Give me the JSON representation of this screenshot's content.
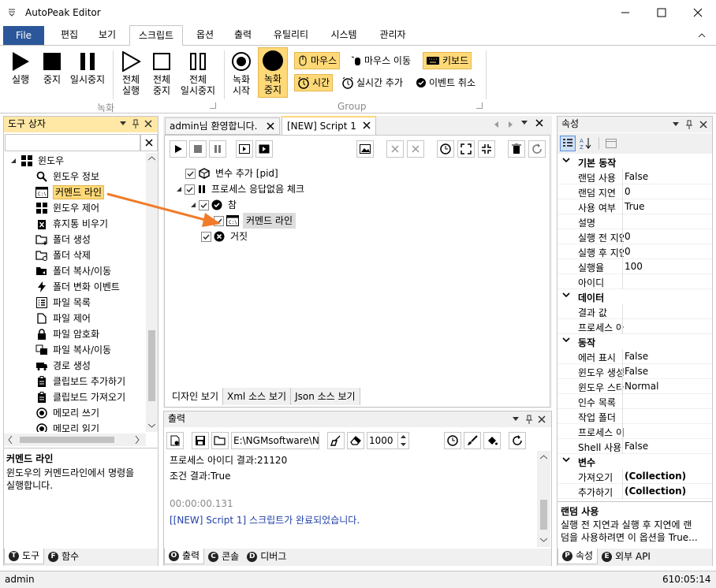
{
  "window": {
    "title": "AutoPeak Editor"
  },
  "menu": {
    "tabs": [
      "File",
      "편집",
      "보기",
      "스크립트",
      "옵션",
      "출력",
      "유틸리티",
      "시스템",
      "관리자"
    ],
    "active": "스크립트"
  },
  "ribbon": {
    "rec_buttons": [
      {
        "line1": "실행",
        "line2": ""
      },
      {
        "line1": "중지",
        "line2": ""
      },
      {
        "line1": "일시중지",
        "line2": ""
      },
      {
        "line1": "전체",
        "line2": "실행"
      },
      {
        "line1": "전체",
        "line2": "중지"
      },
      {
        "line1": "전체",
        "line2": "일시중지"
      }
    ],
    "rec_group_label": "녹화",
    "record_start": {
      "line1": "녹화",
      "line2": "시작"
    },
    "record_stop": {
      "line1": "녹화",
      "line2": "중지"
    },
    "small_buttons": {
      "mouse": "마우스",
      "mouse_move": "마우스 이동",
      "keyboard": "키보드",
      "time": "시간",
      "realtime_add": "실시간 추가",
      "event_cancel": "이벤트 취소"
    },
    "group_label": "Group"
  },
  "toolbox": {
    "title": "도구 상자",
    "search_value": "",
    "category": "윈도우",
    "items": [
      "윈도우 정보",
      "커멘드 라인",
      "윈도우 제어",
      "휴지통 비우기",
      "폴더 생성",
      "폴더 삭제",
      "폴더 복사/이동",
      "폴더 변화 이벤트",
      "파일 목록",
      "파일 제어",
      "파일 암호화",
      "파일 복사/이동",
      "경로 생성",
      "클립보드 추가하기",
      "클립보드 가져오기",
      "메모리 쓰기",
      "메모리 읽기"
    ],
    "selected": "커멘드 라인",
    "desc_title": "커멘드 라인",
    "desc_text1": "윈도우의 커멘드라인에서 명령을",
    "desc_text2": "실행합니다.",
    "tabs": [
      "도구",
      "함수"
    ]
  },
  "editor": {
    "tabs": [
      "admin님 환영합니다.",
      "[NEW] Script 1"
    ],
    "active_tab": "[NEW] Script 1",
    "tree": {
      "n1": "변수 추가 [pid]",
      "n2": "프로세스 응답없음 체크",
      "n3": "참",
      "n4": "커멘드 라인",
      "n5": "거짓"
    },
    "view_tabs": [
      "디자인 보기",
      "Xml 소스 보기",
      "Json 소스 보기"
    ]
  },
  "output": {
    "title": "출력",
    "path_value": "E:\\NGMsoftware\\NG",
    "count_value": "1000",
    "lines": {
      "l1": "프로세스 아이디 결과:21120",
      "l2": "조건 결과:True",
      "l3": "00:00:00.131",
      "l4": "[[NEW] Script 1] 스크립트가 완료되었습니다."
    },
    "tabs": [
      "출력",
      "콘솔",
      "디버그"
    ]
  },
  "properties": {
    "title": "속성",
    "cat1": "기본 동작",
    "rows1": [
      {
        "k": "랜덤 사용",
        "v": "False"
      },
      {
        "k": "랜덤 지연",
        "v": "0"
      },
      {
        "k": "사용 여부",
        "v": "True"
      },
      {
        "k": "설명",
        "v": ""
      },
      {
        "k": "실행 전 지연",
        "v": "0"
      },
      {
        "k": "실행 후 지연",
        "v": "0"
      },
      {
        "k": "실행율",
        "v": "100"
      },
      {
        "k": "아이디",
        "v": ""
      }
    ],
    "cat2": "데이터",
    "rows2": [
      {
        "k": "결과 값",
        "v": ""
      },
      {
        "k": "프로세스 아이디",
        "v": ""
      }
    ],
    "cat3": "동작",
    "rows3": [
      {
        "k": "에러 표시",
        "v": "False"
      },
      {
        "k": "윈도우 생성",
        "v": "False"
      },
      {
        "k": "윈도우 스타일",
        "v": "Normal"
      },
      {
        "k": "인수 목록",
        "v": ""
      },
      {
        "k": "작업 폴더",
        "v": ""
      },
      {
        "k": "프로세스 이름",
        "v": ""
      },
      {
        "k": "Shell 사용",
        "v": "False"
      }
    ],
    "cat4": "변수",
    "rows4": [
      {
        "k": "가져오기",
        "v": "(Collection)"
      },
      {
        "k": "추가하기",
        "v": "(Collection)"
      }
    ],
    "desc_title": "랜덤 사용",
    "desc_text1": "실행 전 지연과 실행 후 지연에 랜",
    "desc_text2": "덤을 사용하려면 이 옵션을 True...",
    "tabs": [
      "속성",
      "외부 API"
    ]
  },
  "status": {
    "user": "admin",
    "time": "610:05:14"
  },
  "colors": {
    "accent": "#2b579a",
    "highlight": "#ffd978",
    "panel_title": "#ffe8a6",
    "arrow": "#f07b2a",
    "link_text": "#1f3fa8"
  }
}
